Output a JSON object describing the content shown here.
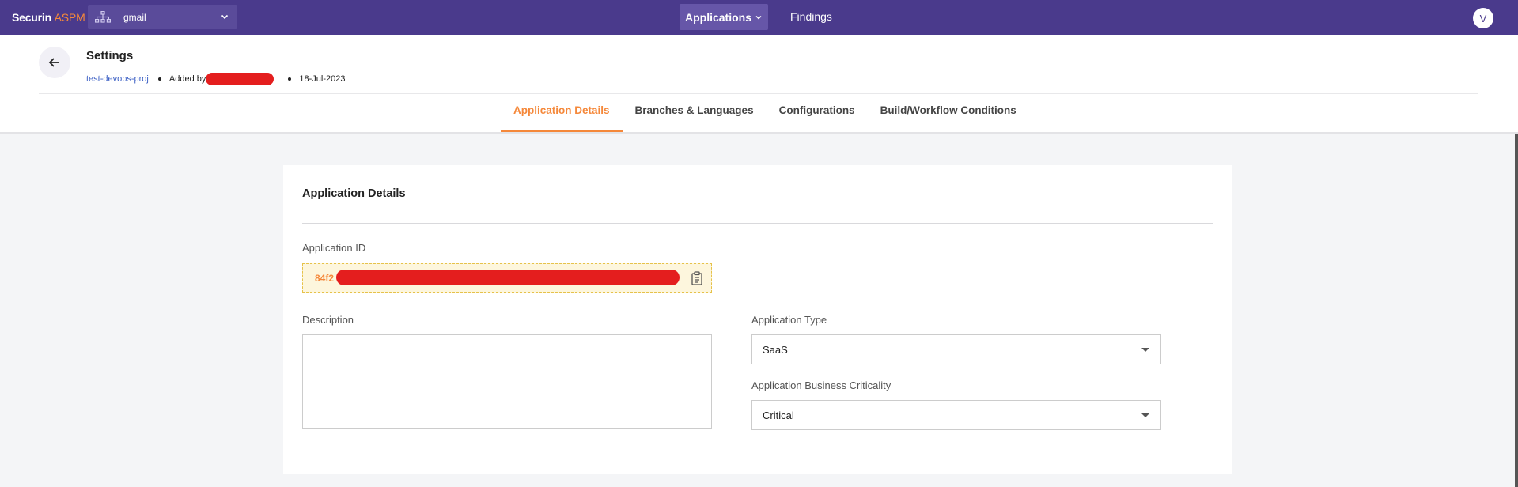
{
  "topnav": {
    "brand_main": "Securin",
    "brand_accent": "ASPM",
    "org_name": "gmail",
    "apps_label": "Applications",
    "findings_label": "Findings",
    "avatar_initial": "V"
  },
  "header": {
    "title": "Settings",
    "project": "test-devops-proj",
    "added_by_label": "Added by",
    "date": "18-Jul-2023",
    "tabs": [
      {
        "label": "Application Details",
        "active": true
      },
      {
        "label": "Branches & Languages",
        "active": false
      },
      {
        "label": "Configurations",
        "active": false
      },
      {
        "label": "Build/Workflow Conditions",
        "active": false
      }
    ]
  },
  "card": {
    "title": "Application Details",
    "app_id_label": "Application ID",
    "app_id_value": "84f2",
    "description_label": "Description",
    "description_value": "",
    "app_type_label": "Application Type",
    "app_type_value": "SaaS",
    "criticality_label": "Application Business Criticality",
    "criticality_value": "Critical"
  },
  "colors": {
    "nav_bg": "#4a3a8c",
    "accent": "#f5883a",
    "link": "#3b5fc4",
    "redaction": "#e41e1e"
  },
  "icons": {
    "org": "org-tree-icon",
    "back": "arrow-left-icon",
    "copy": "clipboard-icon"
  }
}
